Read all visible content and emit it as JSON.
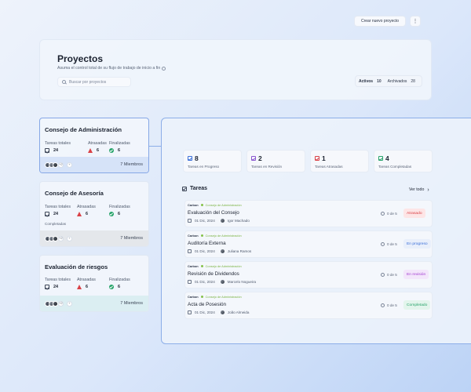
{
  "header": {
    "title": "Proyectos",
    "subtitle": "Asuma el control total de su flujo de trabajo de inicio a fin",
    "search_placeholder": "Buscar por proyectos",
    "create_button": "Crear nuevo proyecto",
    "more_button": "⋮",
    "tabs": [
      {
        "label": "Activos",
        "count": "10"
      },
      {
        "label": "Archivados",
        "count": "28"
      }
    ]
  },
  "projects": [
    {
      "name": "Consejo de Administración",
      "labels": {
        "total": "Tareas totales",
        "late": "Atrasadas",
        "done": "Finalizadas"
      },
      "total": "24",
      "late": "6",
      "done": "6",
      "progress": 0.5,
      "more_avatars": "+2",
      "members": "7 Miembros"
    },
    {
      "name": "Consejo de Asesoría",
      "labels": {
        "total": "Tareas totales",
        "late": "Atrasadas",
        "done": "Finalizadas"
      },
      "total": "24",
      "late": "6",
      "done": "6",
      "completed_label": "Completadas",
      "progress": 0.5,
      "more_avatars": "+2",
      "members": "7 Miembros"
    },
    {
      "name": "Evaluación de riesgos",
      "labels": {
        "total": "Tareas totales",
        "late": "Atrasadas",
        "done": "Finalizadas"
      },
      "total": "24",
      "late": "6",
      "done": "6",
      "progress": 0.5,
      "more_avatars": "+2",
      "members": "7 Miembros"
    }
  ],
  "summary": [
    {
      "count": "8",
      "label": "Tareas en Progreso",
      "color": "blue"
    },
    {
      "count": "2",
      "label": "Tareas en Revisión",
      "color": "purple"
    },
    {
      "count": "1",
      "label": "Tareas Atrasadas",
      "color": "red"
    },
    {
      "count": "4",
      "label": "Tareas Completadas",
      "color": "green"
    }
  ],
  "tasks_section": {
    "title": "Tareas",
    "view_all": "Ver todo"
  },
  "tasks": [
    {
      "client": "Carbon",
      "board": "Consejo de Administración",
      "name": "Evaluación del Consejo",
      "date": "01 Dic, 2024",
      "assignee": "Igor Machado",
      "progress": "0 de 5",
      "status": "Atrasado",
      "status_color": "#d94046",
      "status_bg": "#fde5e6"
    },
    {
      "client": "Carbon",
      "board": "Consejo de Administración",
      "name": "Auditoría Externa",
      "date": "01 Dic, 2024",
      "assignee": "Juliana Ramos",
      "progress": "0 de 5",
      "status": "En progreso",
      "status_color": "#3a6fd8",
      "status_bg": "#e9effb"
    },
    {
      "client": "Carbon",
      "board": "Consejo de Administración",
      "name": "Revisión de Dividendos",
      "date": "01 Dic, 2024",
      "assignee": "Marcelo Nogueira",
      "progress": "0 de 5",
      "status": "En revisión",
      "status_color": "#a13ad0",
      "status_bg": "#f3e6fb"
    },
    {
      "client": "Carbon",
      "board": "Consejo de Administración",
      "name": "Acta de Posesión",
      "date": "01 Dic, 2024",
      "assignee": "João Almeida",
      "progress": "0 de 5",
      "status": "Completado",
      "status_color": "#27a36a",
      "status_bg": "#e3f5ec"
    }
  ],
  "colors": {
    "accent": "#86a7e6",
    "progress_green": "#27a36a",
    "progress_blue": "#3a6fd8"
  }
}
